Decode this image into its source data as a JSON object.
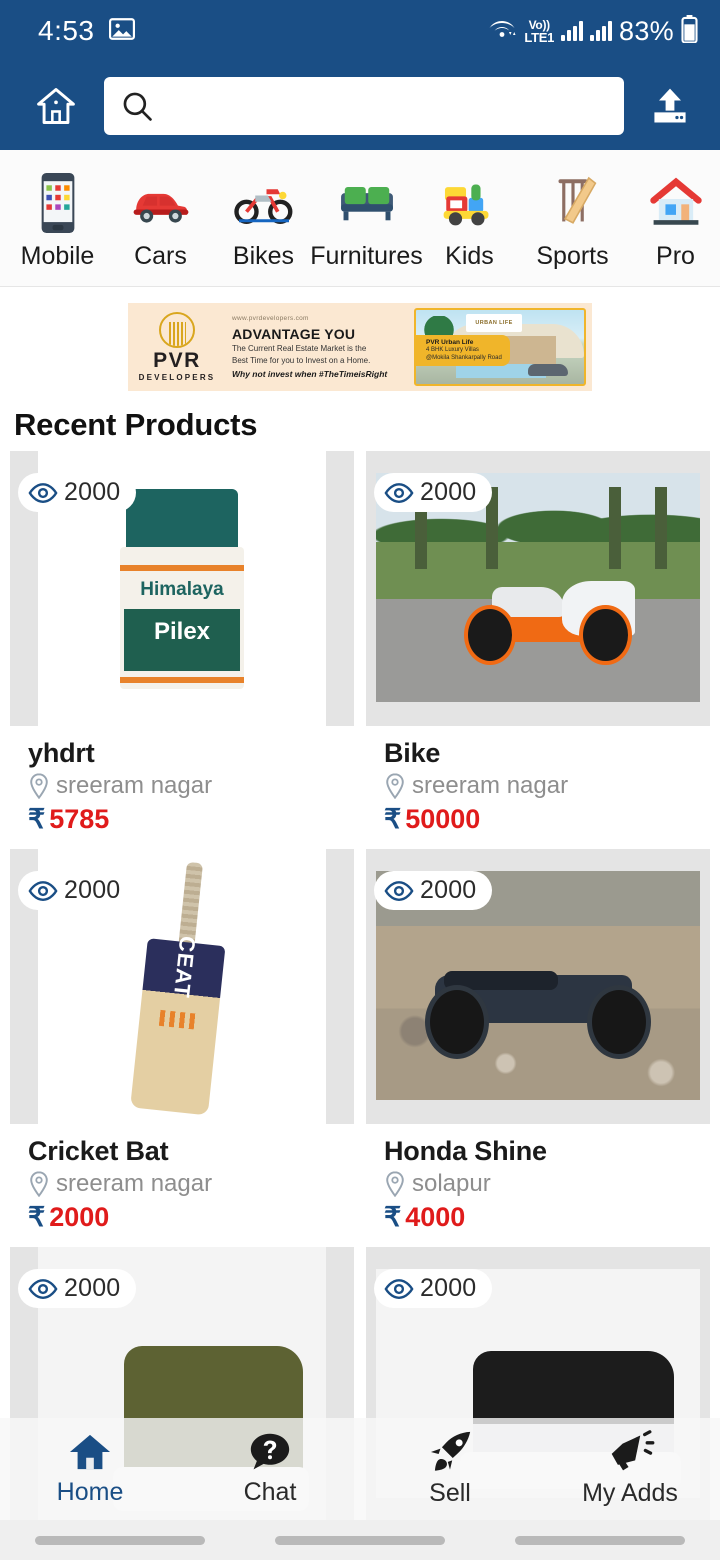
{
  "status_bar": {
    "time": "4:53",
    "image_icon": "image-icon",
    "wifi_icon": "wifi-icon",
    "volte_top": "Vo))",
    "volte_bottom": "LTE1",
    "signal_icon_1": "signal-bars-icon",
    "signal_icon_2": "signal-bars-icon",
    "battery_percent": "83%",
    "battery_icon": "battery-icon"
  },
  "app_bar": {
    "home_icon": "home-icon",
    "search_icon": "search-icon",
    "search_value": "",
    "search_placeholder": "",
    "upload_icon": "upload-icon",
    "background_color": "#1a4e85"
  },
  "categories": [
    {
      "label": "Mobile",
      "icon": "mobile-phone-icon"
    },
    {
      "label": "Cars",
      "icon": "car-icon"
    },
    {
      "label": "Bikes",
      "icon": "motorcycle-icon"
    },
    {
      "label": "Furnitures",
      "icon": "sofa-icon"
    },
    {
      "label": "Kids",
      "icon": "toy-train-icon"
    },
    {
      "label": "Sports",
      "icon": "cricket-bat-icon"
    },
    {
      "label": "Pro",
      "icon": "house-icon"
    }
  ],
  "banner": {
    "brand": "PVR",
    "brand_sub": "DEVELOPERS",
    "url": "www.pvrdevelopers.com",
    "headline": "ADVANTAGE YOU",
    "body_line1": "The Current Real Estate Market is the",
    "body_line2": "Best Time for you to Invest on a Home.",
    "cta": "Why not invest when #TheTimeisRight",
    "project_logo": "URBAN LIFE",
    "tag_line1": "PVR Urban Life",
    "tag_line2": "4 BHK Luxury Villas",
    "tag_line3": "@Mokila Shankarpally Road",
    "background_color": "#fbe8d2",
    "accent_color": "#f0b52a"
  },
  "section": {
    "title": "Recent Products"
  },
  "products": [
    {
      "views": "2000",
      "views_icon": "eye-icon",
      "title": "yhdrt",
      "location_icon": "location-pin-icon",
      "location": "sreeram nagar",
      "currency": "₹",
      "price": "5785",
      "art": "pilex-bottle"
    },
    {
      "views": "2000",
      "views_icon": "eye-icon",
      "title": "Bike",
      "location_icon": "location-pin-icon",
      "location": "sreeram nagar",
      "currency": "₹",
      "price": "50000",
      "art": "ktm-sportbike-photo"
    },
    {
      "views": "2000",
      "views_icon": "eye-icon",
      "title": "Cricket Bat",
      "location_icon": "location-pin-icon",
      "location": "sreeram nagar",
      "currency": "₹",
      "price": "2000",
      "art": "cricket-bat"
    },
    {
      "views": "2000",
      "views_icon": "eye-icon",
      "title": "Honda Shine",
      "location_icon": "location-pin-icon",
      "location": "solapur",
      "currency": "₹",
      "price": "4000",
      "art": "honda-shine-photo"
    },
    {
      "views": "2000",
      "views_icon": "eye-icon",
      "title": "",
      "location_icon": "location-pin-icon",
      "location": "",
      "currency": "₹",
      "price": "",
      "art": "olive-sneakers"
    },
    {
      "views": "2000",
      "views_icon": "eye-icon",
      "title": "",
      "location_icon": "location-pin-icon",
      "location": "",
      "currency": "₹",
      "price": "",
      "art": "black-white-sneakers"
    }
  ],
  "bottom_nav": {
    "items": [
      {
        "label": "Home",
        "icon": "home-icon",
        "active": true
      },
      {
        "label": "Chat",
        "icon": "question-chat-icon",
        "active": false
      },
      {
        "label": "Sell",
        "icon": "rocket-icon",
        "active": false
      },
      {
        "label": "My Adds",
        "icon": "megaphone-icon",
        "active": false
      }
    ],
    "active_color": "#1a4e85"
  }
}
